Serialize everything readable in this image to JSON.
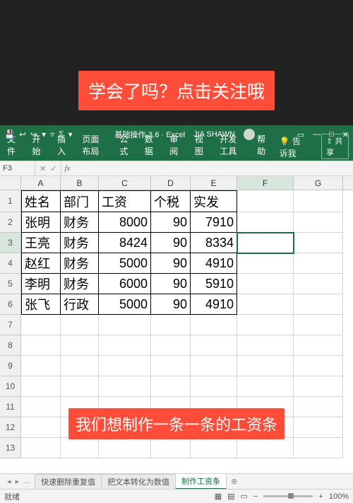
{
  "banners": {
    "top": "学会了吗？点击关注哦",
    "bottom": "我们想制作一条一条的工资条"
  },
  "titlebar": {
    "doc": "基础操作-3.6 · Excel",
    "user": "JIA SHAWN"
  },
  "ribbon": {
    "tabs": [
      "文件",
      "开始",
      "插入",
      "页面布局",
      "公式",
      "数据",
      "审阅",
      "视图",
      "开发工具",
      "帮助"
    ],
    "tell": "告诉我",
    "share": "共享"
  },
  "formulaBar": {
    "nameBox": "F3",
    "formula": ""
  },
  "columns": [
    "A",
    "B",
    "C",
    "D",
    "E",
    "F",
    "G"
  ],
  "selected": {
    "col": "F",
    "row": 3
  },
  "rowCount": 13,
  "dataRows": 6,
  "table": {
    "headers": [
      "姓名",
      "部门",
      "工资",
      "个税",
      "实发"
    ],
    "rows": [
      {
        "name": "张明",
        "dept": "财务",
        "salary": 8000,
        "tax": 90,
        "net": 7910
      },
      {
        "name": "王亮",
        "dept": "财务",
        "salary": 8424,
        "tax": 90,
        "net": 8334
      },
      {
        "name": "赵红",
        "dept": "财务",
        "salary": 5000,
        "tax": 90,
        "net": 4910
      },
      {
        "name": "李明",
        "dept": "财务",
        "salary": 6000,
        "tax": 90,
        "net": 5910
      },
      {
        "name": "张飞",
        "dept": "行政",
        "salary": 5000,
        "tax": 90,
        "net": 4910
      }
    ]
  },
  "sheetTabs": {
    "tabs": [
      "快速删除重复值",
      "把文本转化为数值",
      "制作工资条"
    ],
    "active": 2
  },
  "statusbar": {
    "ready": "就绪",
    "zoom": "100%"
  }
}
